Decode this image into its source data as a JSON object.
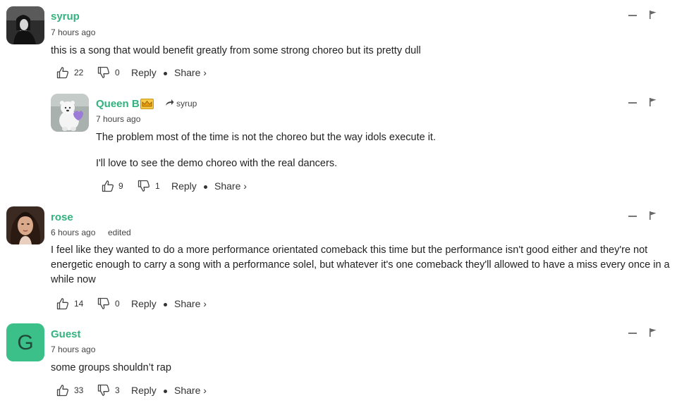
{
  "comments": [
    {
      "name": "syrup",
      "time": "7 hours ago",
      "text": "this is a song that would benefit greatly from some strong choreo but its pretty dull",
      "likes": "22",
      "dislikes": "0",
      "reply_label": "Reply",
      "share_label": "Share ›"
    },
    {
      "name": "Queen B",
      "badge": "crown-icon",
      "reply_to": "syrup",
      "time": "7 hours ago",
      "text": "The problem most of the time is not the choreo but the way idols execute it.",
      "text2": "I'll love to see the demo choreo with the real dancers.",
      "likes": "9",
      "dislikes": "1",
      "reply_label": "Reply",
      "share_label": "Share ›"
    },
    {
      "name": "rose",
      "time": "6 hours ago",
      "edited": "edited",
      "text": "I feel like they wanted to do a more performance orientated comeback this time but the performance isn't good either and they're not energetic enough to carry a song with a performance solel, but whatever it's one comeback they'll allowed to have a miss every once in a while now",
      "likes": "14",
      "dislikes": "0",
      "reply_label": "Reply",
      "share_label": "Share ›"
    },
    {
      "name": "Guest",
      "avatar_letter": "G",
      "time": "7 hours ago",
      "text": "some groups shouldn’t rap",
      "likes": "33",
      "dislikes": "3",
      "reply_label": "Reply",
      "share_label": "Share ›"
    }
  ],
  "colors": {
    "username": "#33b27f",
    "guest_avatar": "#3cc08a"
  }
}
